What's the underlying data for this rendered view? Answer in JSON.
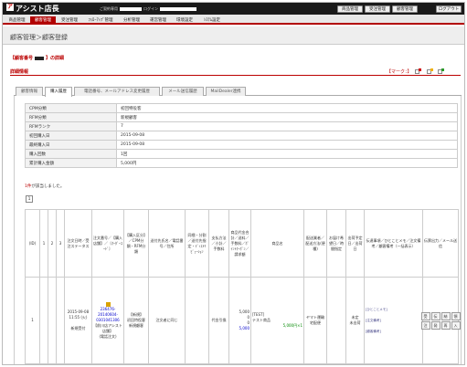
{
  "app": {
    "logo_mark": "ア",
    "logo_text": "アシスト店長",
    "welcome_prefix": "ご契約専用",
    "login_label": "ログイン"
  },
  "top_buttons": {
    "product_mgmt": "商品管理",
    "order_mgmt": "受注管理",
    "customer_mgmt": "顧客管理",
    "logout": "ログアウト"
  },
  "nav": [
    "商品管理",
    "顧客管理",
    "受注管理",
    "ﾌｫﾛｰｱｯﾌﾟ管理",
    "分析管理",
    "運営管理",
    "環境設定",
    "ｼｽﾃﾑ設定"
  ],
  "breadcrumb": "顧客管理＞顧客登録",
  "detail_title": {
    "prefix": "【顧客番号",
    "suffix": "】の詳細"
  },
  "section": {
    "title": "詳細情報",
    "marker_label": "【マーク：】"
  },
  "marker_colors": [
    "#d00000",
    "#f0b000",
    "#2a9a2a"
  ],
  "tabs": [
    "顧客情報",
    "購入履歴",
    "電話番号、メールアドレス変更履歴",
    "メール送信履歴",
    "MailDealer連携"
  ],
  "info_rows": [
    {
      "k": "CPM分類",
      "v": "初回特役客"
    },
    {
      "k": "RFM分類",
      "v": "新規顧客"
    },
    {
      "k": "RFMランク",
      "v": "7"
    },
    {
      "k": "初回購入日",
      "v": "2015-09-08"
    },
    {
      "k": "最終購入日",
      "v": "2015-09-08"
    },
    {
      "k": "購入回数",
      "v": "1回"
    },
    {
      "k": "累計購入金額",
      "v": "5,000円"
    }
  ],
  "count_message": {
    "count": "1件",
    "text": "が該当しました。"
  },
  "pager": "1",
  "grid": {
    "headers": [
      "(ID)",
      "1",
      "2",
      "3",
      "注文日時／受注ステータス",
      "注文番号／【購入店舗】／〔ｵｰﾀﾞｰｺｰﾄﾞ〕",
      "【購入区分】／CPM分類・RFM分類",
      "送付先氏名／電話番号／住所",
      "同梱・分割／送付先指定・ﾃﾞｨｽﾄﾘﾋﾞｭｰｼｮﾝ",
      "支払方法／小計／手数料",
      "商品代金合計／送料／手数料／ﾎﾟｲﾝﾄｸｰﾎﾟﾝ／請求額",
      "商品名",
      "配送業者／配送方法(便種)",
      "お届け希望日／時間指定",
      "出荷予定日／出荷日",
      "伝達事項／ひとことメモ／注文備考／顧客備考（一括表示）",
      "伝票出力／メール送信"
    ],
    "row": {
      "id": "1",
      "date": "2015-09-08 11:55 (火)",
      "status": "新規受付",
      "order_no": "236476-20140604-0301041306",
      "shop": "【前川店アシスト店舗】",
      "code": "(電話注文)",
      "buy_type": "【新規】",
      "cpm": "初回特役客",
      "rfm": "新規顧客",
      "dest": "注文者に同じ",
      "pay": "代金引換",
      "sub": "5,000",
      "fee": "0",
      "total": "5,000",
      "point": "0",
      "bill": "5,000",
      "product_tag": "[TEST]",
      "product": "テスト商品",
      "product_price": "5,000円×1",
      "carrier": "ヤマト運輸",
      "method": "宅配便",
      "ship": "未定",
      "ship2": "未出荷",
      "memo1": "[ひとことメモ]",
      "memo2": "[注文備考]",
      "memo3": "[顧客備考]",
      "action_buttons": [
        "受",
        "伝",
        "納",
        "領",
        "注",
        "発",
        "再",
        "入"
      ]
    }
  }
}
